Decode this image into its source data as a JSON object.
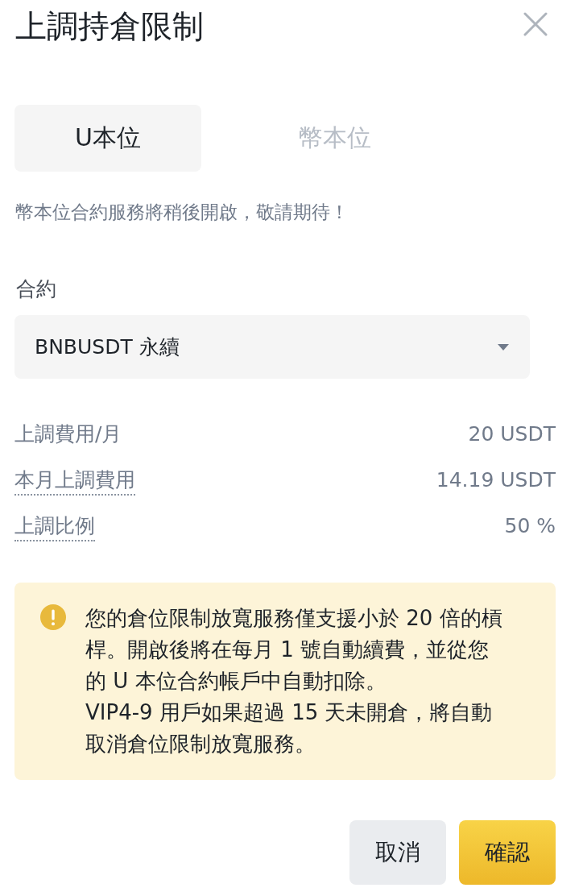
{
  "dialog": {
    "title": "上調持倉限制"
  },
  "tabs": [
    {
      "label": "U本位",
      "selected": true
    },
    {
      "label": "幣本位",
      "selected": false
    }
  ],
  "tab_note": "幣本位合約服務將稍後開啟，敬請期待！",
  "contract": {
    "label": "合約",
    "value": "BNBUSDT 永續"
  },
  "fees": [
    {
      "label": "上調費用/月",
      "value": "20 USDT",
      "tooltip": false
    },
    {
      "label": "本月上調費用",
      "value": "14.19 USDT",
      "tooltip": true
    },
    {
      "label": "上調比例",
      "value": "50 %",
      "tooltip": true
    }
  ],
  "notice": {
    "paragraphs": [
      "您的倉位限制放寬服務僅支援小於 20 倍的槓桿。開啟後將在每月 1 號自動續費，並從您的 U 本位合約帳戶中自動扣除。",
      "VIP4-9 用戶如果超過 15 天未開倉，將自動取消倉位限制放寬服務。"
    ]
  },
  "buttons": [
    {
      "label": "取消",
      "kind": "secondary"
    },
    {
      "label": "確認",
      "kind": "primary"
    }
  ]
}
